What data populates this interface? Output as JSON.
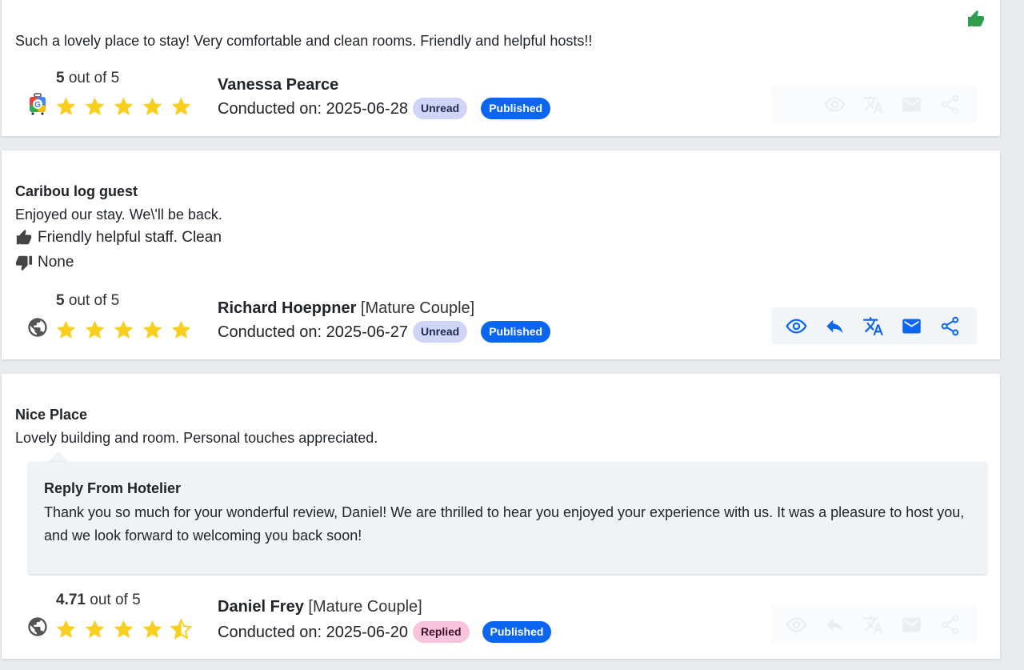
{
  "colors": {
    "accent": "#0a66f0",
    "star": "#f8cf1e",
    "thumb_green": "#2e9e4b",
    "badge_unread": "#cfd5f7",
    "badge_replied": "#f8c3dc"
  },
  "reviews": [
    {
      "text": "Such a lovely place to stay! Very comfortable and clean rooms. Friendly and helpful hosts!!",
      "score": "5",
      "score_suffix": "out of 5",
      "rating": 5,
      "source_icon": "google-travel-icon",
      "reviewer": "Vanessa Pearce",
      "conducted": "Conducted on: 2025-06-28",
      "status": "Unread",
      "publish": "Published",
      "actions": [
        "view-icon",
        "translate-icon",
        "email-icon",
        "share-icon"
      ]
    },
    {
      "title": "Caribou log guest",
      "text": "Enjoyed our stay. We\\'ll be back.",
      "pros": "Friendly helpful staff. Clean",
      "cons": "None",
      "score": "5",
      "score_suffix": "out of 5",
      "rating": 5,
      "source_icon": "globe-icon",
      "reviewer": "Richard Hoeppner",
      "group": "[Mature Couple]",
      "conducted": "Conducted on: 2025-06-27",
      "status": "Unread",
      "publish": "Published",
      "actions": [
        "view-icon",
        "reply-icon",
        "translate-icon",
        "email-icon",
        "share-icon"
      ]
    },
    {
      "title": "Nice Place",
      "text": "Lovely building and room. Personal touches appreciated.",
      "reply_title": "Reply From Hotelier",
      "reply_text": "Thank you so much for your wonderful review, Daniel! We are thrilled to hear you enjoyed your experience with us. It was a pleasure to host you, and we look forward to welcoming you back soon!",
      "score": "4.71",
      "score_suffix": "out of 5",
      "rating": 4.71,
      "source_icon": "globe-icon",
      "reviewer": "Daniel Frey",
      "group": "[Mature Couple]",
      "conducted": "Conducted on: 2025-06-20",
      "status": "Replied",
      "publish": "Published",
      "actions": [
        "view-icon",
        "reply-icon",
        "translate-icon",
        "email-icon",
        "share-icon"
      ]
    }
  ]
}
